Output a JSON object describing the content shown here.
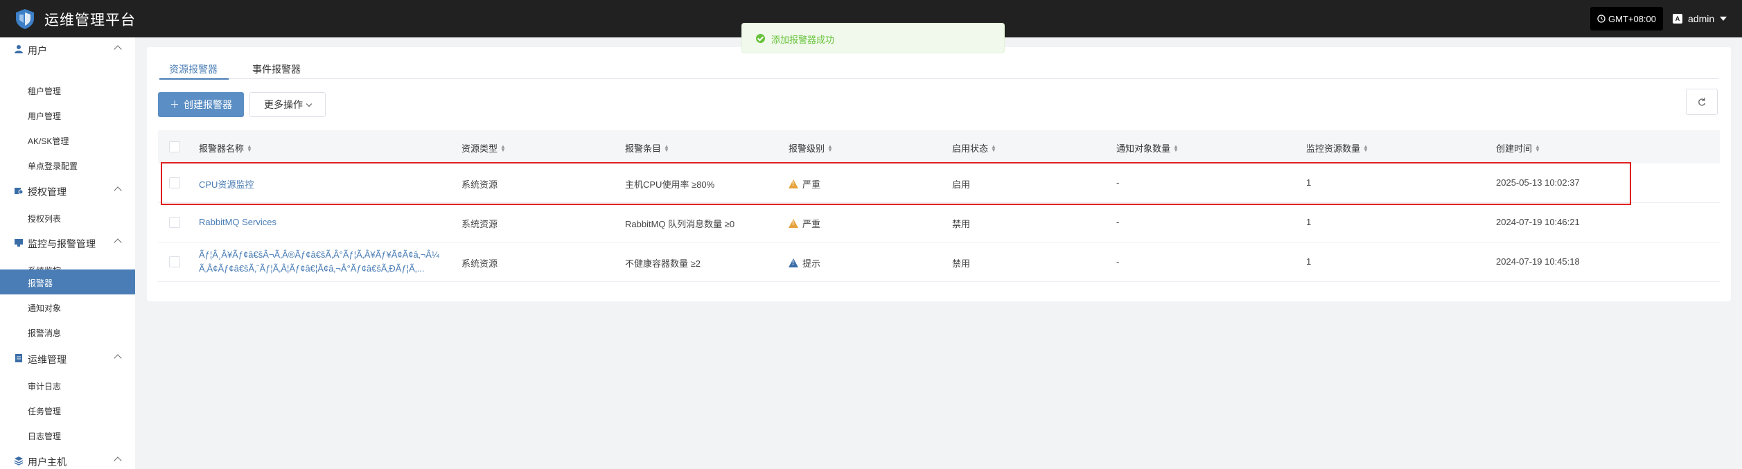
{
  "header": {
    "title": "运维管理平台",
    "timezone": "GMT+08:00",
    "user": "admin",
    "user_badge": "A"
  },
  "toast": {
    "message": "添加报警器成功",
    "type": "success"
  },
  "sidebar": {
    "groups": [
      {
        "label": "用户",
        "icon": "user-icon",
        "items": [
          "租户管理",
          "用户管理",
          "AK/SK管理",
          "单点登录配置"
        ]
      },
      {
        "label": "授权管理",
        "icon": "authorize-icon",
        "items": [
          "授权列表"
        ]
      },
      {
        "label": "监控与报警管理",
        "icon": "monitor-icon",
        "items": [
          "系统监控",
          "报警器",
          "通知对象",
          "报警消息"
        ]
      },
      {
        "label": "运维管理",
        "icon": "ops-icon",
        "items": [
          "审计日志",
          "任务管理",
          "日志管理"
        ]
      },
      {
        "label": "用户主机",
        "icon": "host-icon",
        "items": []
      }
    ],
    "active_item": "报警器"
  },
  "tabs": [
    "资源报警器",
    "事件报警器"
  ],
  "toolbar": {
    "create_label": "创建报警器",
    "more_label": "更多操作",
    "refresh_icon": "refresh-icon"
  },
  "table": {
    "columns": [
      "报警器名称",
      "资源类型",
      "报警条目",
      "报警级别",
      "启用状态",
      "通知对象数量",
      "监控资源数量",
      "创建时间"
    ],
    "rows": [
      {
        "name": "CPU资源监控",
        "resource_type": "系统资源",
        "condition": "主机CPU使用率 ≥80%",
        "level": "严重",
        "level_color": "#e6a23c",
        "status": "启用",
        "notify_count": "-",
        "resource_count": "1",
        "created": "2025-05-13 10:02:37"
      },
      {
        "name": "RabbitMQ Services",
        "resource_type": "系统资源",
        "condition": "RabbitMQ 队列消息数量 ≥0",
        "level": "严重",
        "level_color": "#e6a23c",
        "status": "禁用",
        "notify_count": "-",
        "resource_count": "1",
        "created": "2024-07-19 10:46:21"
      },
      {
        "name": "Ãƒ¦Â¸Â¥Ãƒ¢â€šÂ¬Ã‚Â®Ãƒ¢â€šÃ‚Â°Ãƒ¦Ã‚Â¥Ãƒ¥Ã¢Ã¢â‚¬Â¼",
        "name_line2": "Ã‚Â¢Ãƒ¢â€šÃ‚¨Ãƒ¦Ã‚Â¦Ãƒ¢â€¦Ã¢â‚¬Â°Ãƒ¢â€šÃ‚ÐÃƒ¦Ã‚...",
        "resource_type": "系统资源",
        "condition": "不健康容器数量 ≥2",
        "level": "提示",
        "level_color": "#3a6da8",
        "status": "禁用",
        "notify_count": "-",
        "resource_count": "1",
        "created": "2024-07-19 10:45:18"
      }
    ]
  }
}
